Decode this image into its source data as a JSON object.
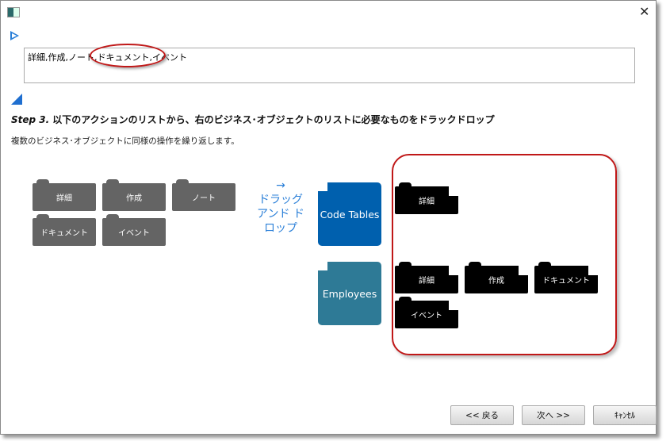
{
  "window": {
    "close_label": "✕"
  },
  "input": {
    "value": "詳細,作成,ノート,ドキュメント,イベント"
  },
  "step": {
    "label": "Step 3.",
    "text": "以下のアクションのリストから、右のビジネス･オブジェクトのリストに必要なものをドラックドロップ"
  },
  "subtitle": "複数のビジネス･オブジェクトに同様の操作を繰り返します。",
  "actions": [
    "詳細",
    "作成",
    "ノート",
    "ドキュメント",
    "イベント"
  ],
  "drag_hint": {
    "arrow": "→",
    "text": "ドラッグ アンド ドロップ"
  },
  "business_objects": [
    {
      "name": "Code Tables",
      "color": "#0060ae",
      "actions": [
        "詳細"
      ]
    },
    {
      "name": "Employees",
      "color": "#2e7a96",
      "actions": [
        "詳細",
        "作成",
        "ドキュメント",
        "イベント"
      ]
    }
  ],
  "buttons": {
    "back": "<< 戻る",
    "next": "次へ >>",
    "cancel": "ｷｬﾝｾﾙ"
  }
}
